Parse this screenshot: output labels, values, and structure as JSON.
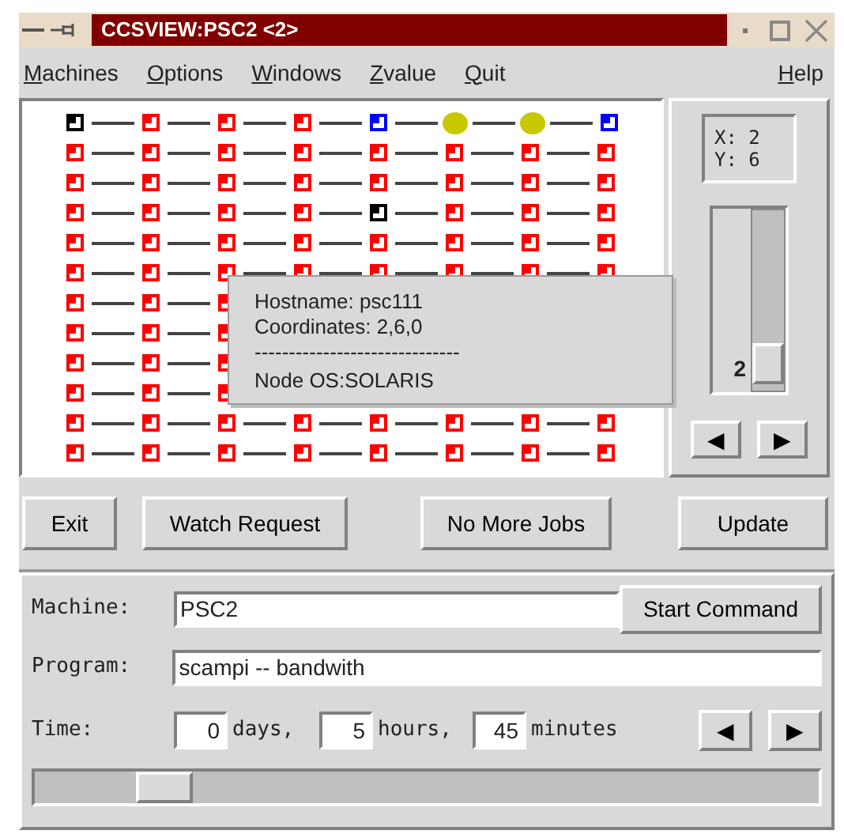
{
  "window": {
    "title": "CCSVIEW:PSC2 <2>"
  },
  "menu": [
    "Machines",
    "Options",
    "Windows",
    "Zvalue",
    "Quit"
  ],
  "help_menu": "Help",
  "grid": [
    [
      {
        "kind": "square",
        "color": "#000000"
      },
      {
        "kind": "square",
        "color": "#ff0000"
      },
      {
        "kind": "square",
        "color": "#ff0000"
      },
      {
        "kind": "square",
        "color": "#ff0000"
      },
      {
        "kind": "square",
        "color": "#0000ff"
      },
      {
        "kind": "circle",
        "color": "#c8c800"
      },
      {
        "kind": "circle",
        "color": "#c8c800"
      },
      {
        "kind": "square",
        "color": "#0000ff"
      }
    ],
    [
      {
        "kind": "square",
        "color": "#ff0000"
      },
      {
        "kind": "square",
        "color": "#ff0000"
      },
      {
        "kind": "square",
        "color": "#ff0000"
      },
      {
        "kind": "square",
        "color": "#ff0000"
      },
      {
        "kind": "square",
        "color": "#ff0000"
      },
      {
        "kind": "square",
        "color": "#ff0000"
      },
      {
        "kind": "square",
        "color": "#ff0000"
      },
      {
        "kind": "square",
        "color": "#ff0000"
      }
    ],
    [
      {
        "kind": "square",
        "color": "#ff0000"
      },
      {
        "kind": "square",
        "color": "#ff0000"
      },
      {
        "kind": "square",
        "color": "#ff0000"
      },
      {
        "kind": "square",
        "color": "#ff0000"
      },
      {
        "kind": "square",
        "color": "#ff0000"
      },
      {
        "kind": "square",
        "color": "#ff0000"
      },
      {
        "kind": "square",
        "color": "#ff0000"
      },
      {
        "kind": "square",
        "color": "#ff0000"
      }
    ],
    [
      {
        "kind": "square",
        "color": "#ff0000"
      },
      {
        "kind": "square",
        "color": "#ff0000"
      },
      {
        "kind": "square",
        "color": "#ff0000"
      },
      {
        "kind": "square",
        "color": "#ff0000"
      },
      {
        "kind": "square",
        "color": "#000000"
      },
      {
        "kind": "square",
        "color": "#ff0000"
      },
      {
        "kind": "square",
        "color": "#ff0000"
      },
      {
        "kind": "square",
        "color": "#ff0000"
      }
    ],
    [
      {
        "kind": "square",
        "color": "#ff0000"
      },
      {
        "kind": "square",
        "color": "#ff0000"
      },
      {
        "kind": "square",
        "color": "#ff0000"
      },
      {
        "kind": "square",
        "color": "#ff0000"
      },
      {
        "kind": "square",
        "color": "#ff0000"
      },
      {
        "kind": "square",
        "color": "#ff0000"
      },
      {
        "kind": "square",
        "color": "#ff0000"
      },
      {
        "kind": "square",
        "color": "#ff0000"
      }
    ],
    [
      {
        "kind": "square",
        "color": "#ff0000"
      },
      {
        "kind": "square",
        "color": "#ff0000"
      },
      {
        "kind": "square",
        "color": "#ff0000"
      },
      {
        "kind": "square",
        "color": "#ff0000"
      },
      {
        "kind": "square",
        "color": "#ff0000"
      },
      {
        "kind": "square",
        "color": "#ff0000"
      },
      {
        "kind": "square",
        "color": "#ff0000"
      },
      {
        "kind": "square",
        "color": "#ff0000"
      }
    ],
    [
      {
        "kind": "square",
        "color": "#ff0000"
      },
      {
        "kind": "square",
        "color": "#ff0000"
      },
      {
        "kind": "square",
        "color": "#ff0000"
      }
    ],
    [
      {
        "kind": "square",
        "color": "#ff0000"
      },
      {
        "kind": "square",
        "color": "#ff0000"
      },
      {
        "kind": "square",
        "color": "#ff0000"
      }
    ],
    [
      {
        "kind": "square",
        "color": "#ff0000"
      },
      {
        "kind": "square",
        "color": "#ff0000"
      },
      {
        "kind": "square",
        "color": "#ff0000"
      }
    ],
    [
      {
        "kind": "square",
        "color": "#ff0000"
      },
      {
        "kind": "square",
        "color": "#ff0000"
      },
      {
        "kind": "square",
        "color": "#ff0000"
      }
    ],
    [
      {
        "kind": "square",
        "color": "#ff0000"
      },
      {
        "kind": "square",
        "color": "#ff0000"
      },
      {
        "kind": "square",
        "color": "#ff0000"
      },
      {
        "kind": "square",
        "color": "#ff0000"
      },
      {
        "kind": "square",
        "color": "#ff0000"
      },
      {
        "kind": "square",
        "color": "#ff0000"
      },
      {
        "kind": "square",
        "color": "#ff0000"
      },
      {
        "kind": "square",
        "color": "#ff0000"
      }
    ],
    [
      {
        "kind": "square",
        "color": "#ff0000"
      },
      {
        "kind": "square",
        "color": "#ff0000"
      },
      {
        "kind": "square",
        "color": "#ff0000"
      },
      {
        "kind": "square",
        "color": "#ff0000"
      },
      {
        "kind": "square",
        "color": "#ff0000"
      },
      {
        "kind": "square",
        "color": "#ff0000"
      },
      {
        "kind": "square",
        "color": "#ff0000"
      },
      {
        "kind": "square",
        "color": "#ff0000"
      }
    ]
  ],
  "tooltip": {
    "lines": [
      "Hostname: psc111",
      "Coordinates: 2,6,0"
    ],
    "separator": "------------------------------",
    "footer": "Node OS:SOLARIS"
  },
  "coords": {
    "x": "X: 2",
    "y": "Y: 6"
  },
  "z_slider": {
    "value": "2",
    "level": 0.04
  },
  "z_buttons": [
    "◀",
    "▶"
  ],
  "buttons": [
    "Exit",
    "Watch Request",
    "No More Jobs",
    "Update"
  ],
  "machine": {
    "label": "Machine:",
    "value": "PSC2"
  },
  "start_button": "Start Command",
  "program": {
    "label": "Program:",
    "value": "scampi -- bandwith"
  },
  "time": {
    "label": "Time:",
    "days": "0",
    "days_unit": "days,",
    "hours": "5",
    "hours_unit": "hours,",
    "minutes": "45",
    "minutes_unit": "minutes"
  },
  "time_buttons": [
    "◀",
    "▶"
  ],
  "time_slider": {
    "level": 0.14
  }
}
